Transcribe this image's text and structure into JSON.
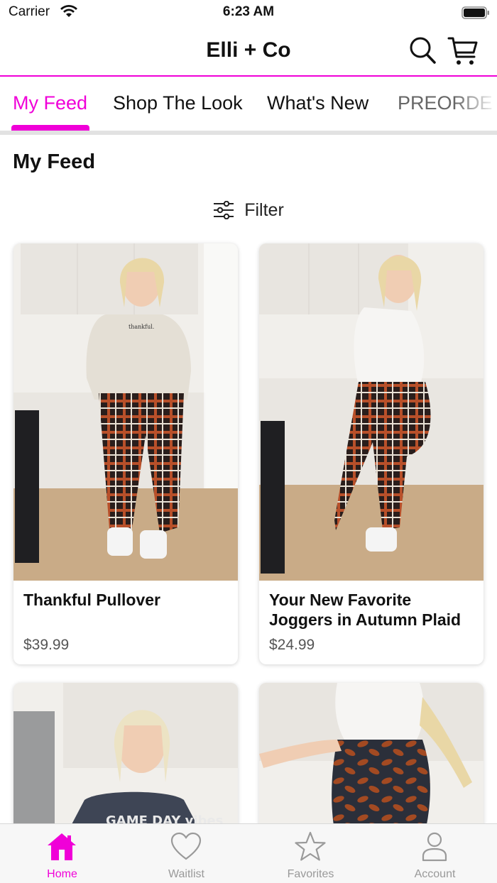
{
  "status_bar": {
    "carrier": "Carrier",
    "time": "6:23 AM"
  },
  "header": {
    "title": "Elli + Co",
    "icons": [
      "search-icon",
      "cart-icon"
    ]
  },
  "tabs": [
    {
      "label": "My Feed",
      "active": true
    },
    {
      "label": "Shop The Look",
      "active": false
    },
    {
      "label": "What's New",
      "active": false
    },
    {
      "label": "PREORDE",
      "active": false
    }
  ],
  "feed": {
    "title": "My Feed",
    "filter_label": "Filter",
    "products": [
      {
        "name": "Thankful Pullover",
        "price": "$39.99"
      },
      {
        "name": "Your New Favorite Joggers in Autumn Plaid",
        "price": "$24.99"
      }
    ],
    "partial_products": [
      {
        "image_text": "GAME DAY vibes"
      },
      {
        "image_text": ""
      }
    ],
    "image_texts": {
      "pullover_print": "thankful."
    }
  },
  "tabbar": [
    {
      "label": "Home",
      "icon": "home-icon",
      "active": true
    },
    {
      "label": "Waitlist",
      "icon": "heart-icon",
      "active": false
    },
    {
      "label": "Favorites",
      "icon": "star-icon",
      "active": false
    },
    {
      "label": "Account",
      "icon": "person-icon",
      "active": false
    }
  ],
  "colors": {
    "accent": "#f000d8",
    "inactive": "#999999",
    "plaid_dark": "#2a1e1c",
    "plaid_rust": "#b8502a"
  }
}
